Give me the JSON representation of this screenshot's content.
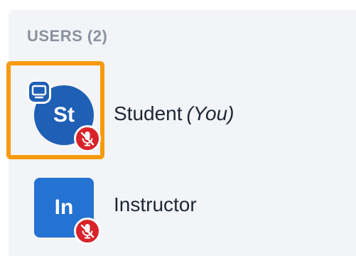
{
  "users_panel": {
    "header": "USERS (2)",
    "users": [
      {
        "initials": "St",
        "name": "Student",
        "tag": "(You)",
        "avatar_shape": "circle",
        "avatar_color": "#1f5fb5",
        "is_presenter": true,
        "mic_status": "muted",
        "focused": true
      },
      {
        "initials": "In",
        "name": "Instructor",
        "avatar_shape": "rounded-square",
        "avatar_color": "#2472d1",
        "is_presenter": false,
        "mic_status": "muted",
        "focused": false
      }
    ]
  },
  "colors": {
    "focus_ring": "#f79a0c",
    "mic_muted": "#d8232a",
    "panel_background": "#f2f4f8",
    "header_text": "#8b929e"
  }
}
